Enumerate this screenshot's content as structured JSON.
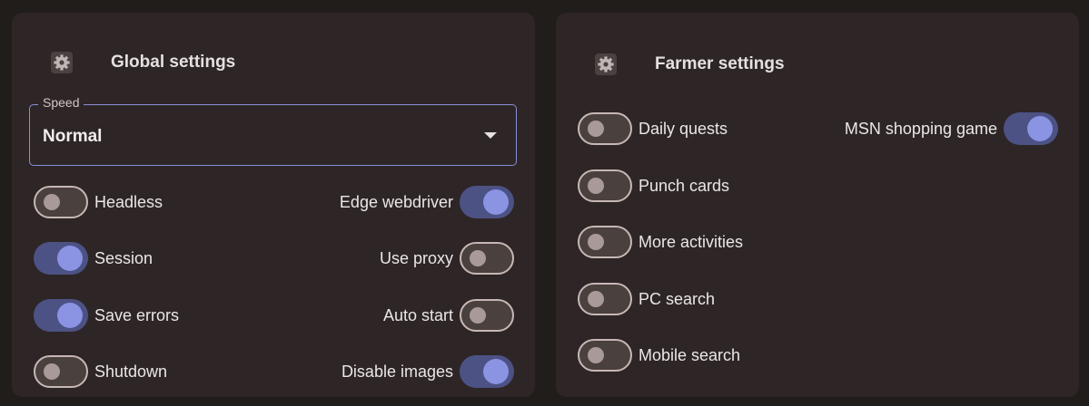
{
  "global": {
    "title": "Global settings",
    "gear_icon": "gear-icon",
    "speed": {
      "label": "Speed",
      "value": "Normal"
    },
    "toggles_left": [
      {
        "label": "Headless",
        "on": false
      },
      {
        "label": "Session",
        "on": true
      },
      {
        "label": "Save errors",
        "on": true
      },
      {
        "label": "Shutdown",
        "on": false
      }
    ],
    "toggles_right": [
      {
        "label": "Edge webdriver",
        "on": true
      },
      {
        "label": "Use proxy",
        "on": false
      },
      {
        "label": "Auto start",
        "on": false
      },
      {
        "label": "Disable images",
        "on": true
      }
    ]
  },
  "farmer": {
    "title": "Farmer settings",
    "gear_icon": "gear-icon",
    "toggles_left": [
      {
        "label": "Daily quests",
        "on": false
      },
      {
        "label": "Punch cards",
        "on": false
      },
      {
        "label": "More activities",
        "on": false
      },
      {
        "label": "PC search",
        "on": false
      },
      {
        "label": "Mobile search",
        "on": false
      }
    ],
    "toggles_right": [
      {
        "label": "MSN shopping game",
        "on": true
      }
    ]
  },
  "colors": {
    "background": "#211d1b",
    "panel": "#2e2626",
    "accent": "#8b93e3",
    "toggle_on_track": "#4d5285",
    "toggle_off_track": "#4a403e"
  }
}
